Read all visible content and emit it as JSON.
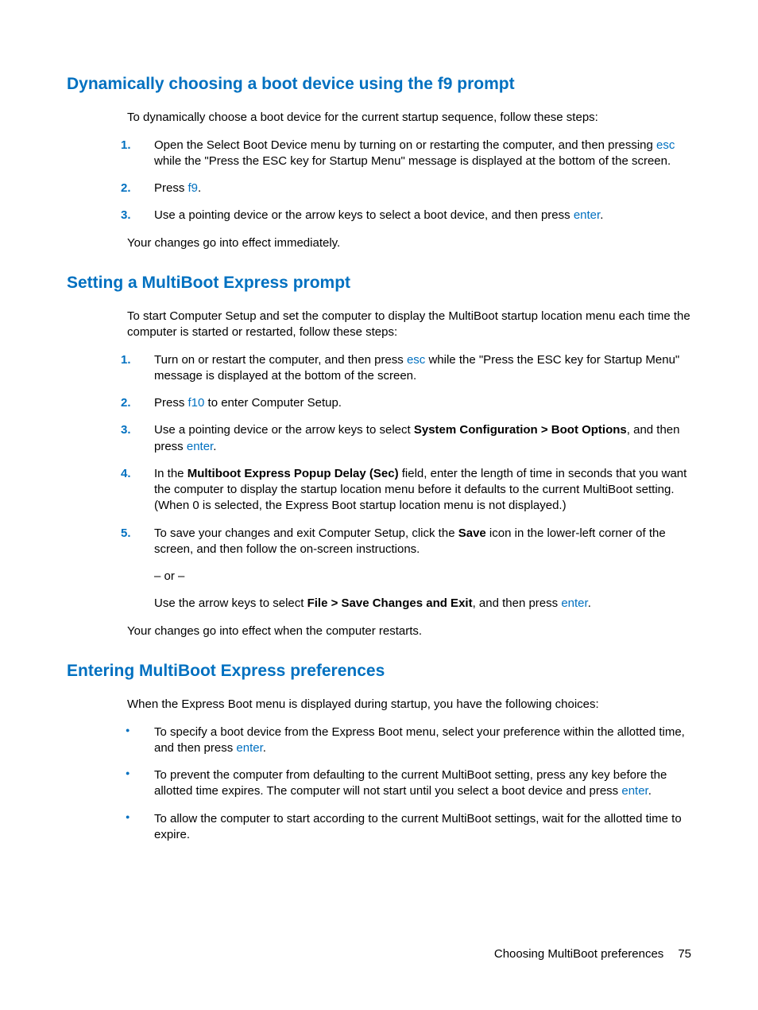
{
  "section1": {
    "heading": "Dynamically choosing a boot device using the f9 prompt",
    "intro": "To dynamically choose a boot device for the current startup sequence, follow these steps:",
    "items": {
      "n1": "1.",
      "t1a": "Open the Select Boot Device menu by turning on or restarting the computer, and then pressing ",
      "t1k": "esc",
      "t1b": " while the \"Press the ESC key for Startup Menu\" message is displayed at the bottom of the screen.",
      "n2": "2.",
      "t2a": "Press ",
      "t2k": "f9",
      "t2b": ".",
      "n3": "3.",
      "t3a": "Use a pointing device or the arrow keys to select a boot device, and then press ",
      "t3k": "enter",
      "t3b": "."
    },
    "after": "Your changes go into effect immediately."
  },
  "section2": {
    "heading": "Setting a MultiBoot Express prompt",
    "intro": "To start Computer Setup and set the computer to display the MultiBoot startup location menu each time the computer is started or restarted, follow these steps:",
    "items": {
      "n1": "1.",
      "t1a": "Turn on or restart the computer, and then press ",
      "t1k": "esc",
      "t1b": " while the \"Press the ESC key for Startup Menu\" message is displayed at the bottom of the screen.",
      "n2": "2.",
      "t2a": "Press ",
      "t2k": "f10",
      "t2b": " to enter Computer Setup.",
      "n3": "3.",
      "t3a": "Use a pointing device or the arrow keys to select ",
      "t3bold": "System Configuration > Boot Options",
      "t3b": ", and then press ",
      "t3k": "enter",
      "t3c": ".",
      "n4": "4.",
      "t4a": "In the ",
      "t4bold": "Multiboot Express Popup Delay (Sec)",
      "t4b": " field, enter the length of time in seconds that you want the computer to display the startup location menu before it defaults to the current MultiBoot setting. (When 0 is selected, the Express Boot startup location menu is not displayed.)",
      "n5": "5.",
      "t5a": "To save your changes and exit Computer Setup, click the ",
      "t5bold": "Save",
      "t5b": " icon in the lower-left corner of the screen, and then follow the on-screen instructions.",
      "t5or": "– or –",
      "t5c": "Use the arrow keys to select ",
      "t5bold2": "File > Save Changes and Exit",
      "t5d": ", and then press ",
      "t5k": "enter",
      "t5e": "."
    },
    "after": "Your changes go into effect when the computer restarts."
  },
  "section3": {
    "heading": "Entering MultiBoot Express preferences",
    "intro": "When the Express Boot menu is displayed during startup, you have the following choices:",
    "items": {
      "b1a": "To specify a boot device from the Express Boot menu, select your preference within the allotted time, and then press ",
      "b1k": "enter",
      "b1b": ".",
      "b2a": "To prevent the computer from defaulting to the current MultiBoot setting, press any key before the allotted time expires. The computer will not start until you select a boot device and press ",
      "b2k": "enter",
      "b2b": ".",
      "b3": "To allow the computer to start according to the current MultiBoot settings, wait for the allotted time to expire."
    }
  },
  "footer": {
    "text": "Choosing MultiBoot preferences",
    "page": "75"
  }
}
